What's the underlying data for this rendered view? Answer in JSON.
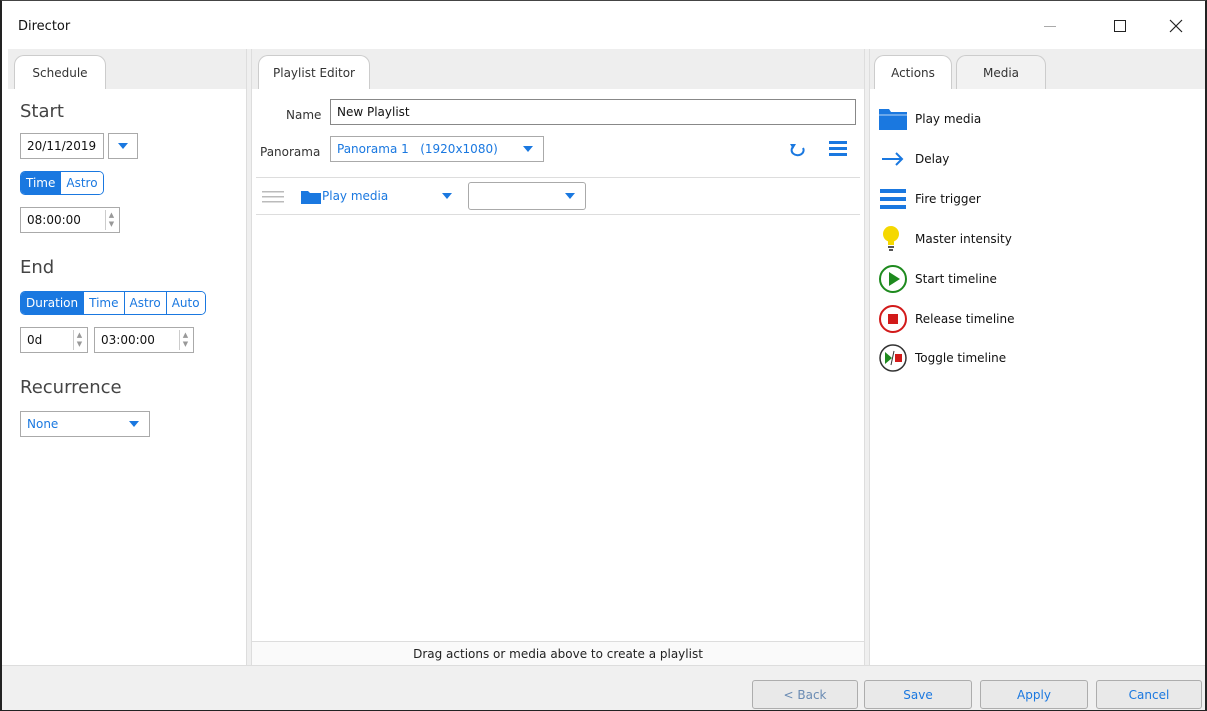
{
  "window": {
    "title": "Director"
  },
  "schedule": {
    "tab": "Schedule",
    "start_heading": "Start",
    "start_date": "20/11/2019",
    "start_modes": [
      "Time",
      "Astro"
    ],
    "start_time": "08:00:00",
    "end_heading": "End",
    "end_modes": [
      "Duration",
      "Time",
      "Astro",
      "Auto"
    ],
    "duration_days": "0d",
    "duration_time": "03:00:00",
    "recurrence_heading": "Recurrence",
    "recurrence_value": "None"
  },
  "playlist": {
    "tab": "Playlist Editor",
    "name_label": "Name",
    "name_value": "New Playlist",
    "panorama_label": "Panorama",
    "panorama_value": "Panorama 1   (1920x1080)",
    "item_action": "Play media",
    "item_media": "",
    "hint": "Drag actions or media above to create a playlist"
  },
  "actions": {
    "tabs": [
      "Actions",
      "Media"
    ],
    "items": [
      {
        "label": "Play media",
        "icon": "folder-icon"
      },
      {
        "label": "Delay",
        "icon": "arrow-right-icon"
      },
      {
        "label": "Fire trigger",
        "icon": "trigger-bars-icon"
      },
      {
        "label": "Master intensity",
        "icon": "lightbulb-icon"
      },
      {
        "label": "Start timeline",
        "icon": "play-circle-icon"
      },
      {
        "label": "Release timeline",
        "icon": "stop-circle-icon"
      },
      {
        "label": "Toggle timeline",
        "icon": "toggle-circle-icon"
      }
    ]
  },
  "footer": {
    "back": "< Back",
    "save": "Save",
    "apply": "Apply",
    "cancel": "Cancel"
  },
  "colors": {
    "accent": "#1a78e0",
    "play": "#1e8a1e",
    "stop": "#d21a1a",
    "bulb": "#f5d800"
  }
}
